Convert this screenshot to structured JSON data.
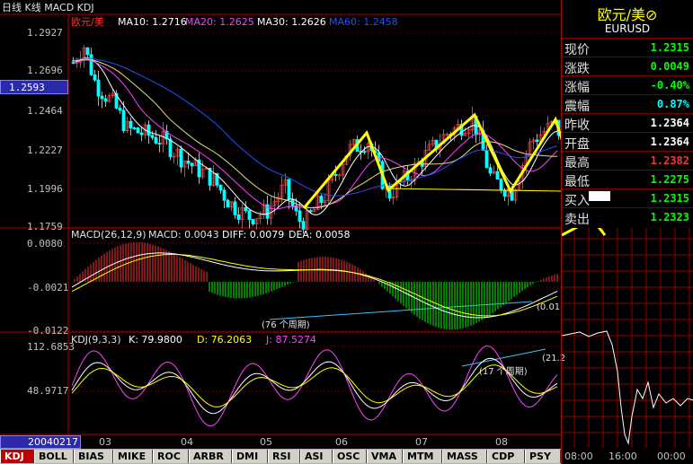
{
  "header": {
    "title": "日线 K线 MACD KDJ"
  },
  "price_panel": {
    "symbol": "欧元/美",
    "ma10": "MA10: 1.2716",
    "ma20": "MA20: 1.2625",
    "ma30": "MA30: 1.2626",
    "ma60": "MA60: 1.2458",
    "yaxis": [
      "1.2927",
      "1.2696",
      "1.2464",
      "1.2227",
      "1.1996",
      "1.1759"
    ],
    "cursor_price": "1.2593"
  },
  "macd_panel": {
    "header": "MACD(26,12,9)",
    "macd": "MACD: 0.0043",
    "diff": "DIFF: 0.0079",
    "dea": "DEA: 0.0058",
    "yaxis": [
      "0.0080",
      "-0.0021",
      "-0.0122"
    ],
    "annotation_left": "(76 个周期)",
    "annotation_right": "(0.01"
  },
  "kdj_panel": {
    "header": "KDJ(9,3,3)",
    "k": "K: 79.9800",
    "d": "D: 76.2063",
    "j": "J: 87.5274",
    "yaxis": [
      "112.6853",
      "48.9717"
    ],
    "annotation_left": "(17 个周期)",
    "annotation_right": "(21.2"
  },
  "xaxis": {
    "date": "20040217",
    "months": [
      "03",
      "04",
      "05",
      "06",
      "07",
      "08"
    ]
  },
  "quote": {
    "title": "欧元/美⊘",
    "code": "EURUSD",
    "rows": [
      {
        "label": "现价",
        "value": "1.2315",
        "color": "#00ff00"
      },
      {
        "label": "涨跌",
        "value": "0.0049",
        "color": "#00ff00"
      },
      {
        "label": "涨幅",
        "value": "-0.40%",
        "color": "#00ff00"
      },
      {
        "label": "震幅",
        "value": "0.87%",
        "color": "#00ffff"
      },
      {
        "label": "昨收",
        "value": "1.2364",
        "color": "#ffffff"
      },
      {
        "label": "开盘",
        "value": "1.2364",
        "color": "#ffffff"
      },
      {
        "label": "最高",
        "value": "1.2382",
        "color": "#ff3030"
      },
      {
        "label": "最低",
        "value": "1.2275",
        "color": "#00ff00"
      },
      {
        "label": "买入",
        "value": "1.2315",
        "color": "#00ff00"
      },
      {
        "label": "卖出",
        "value": "1.2323",
        "color": "#00ff00"
      }
    ],
    "time_labels": [
      "08:00",
      "16:00",
      "00:00"
    ]
  },
  "tabs": [
    "KDJ",
    "BOLL",
    "BIAS",
    "MIKE",
    "ROC",
    "ARBR",
    "DMI",
    "RSI",
    "ASI",
    "OSC",
    "VMA",
    "MTM",
    "MASS",
    "CDP",
    "PSY"
  ],
  "colors": {
    "up": "#ff3030",
    "down": "#00ffff",
    "frame": "#b00000",
    "annotation": "#ffff00"
  }
}
